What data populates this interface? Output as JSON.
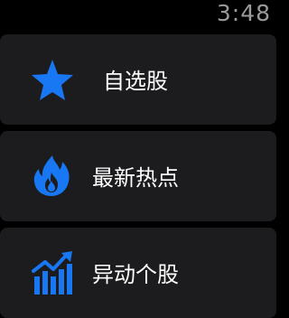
{
  "status": {
    "time": "3:48"
  },
  "accent_color": "#1877f2",
  "menu": {
    "items": [
      {
        "label": "自选股",
        "icon": "star-icon"
      },
      {
        "label": "最新热点",
        "icon": "flame-icon"
      },
      {
        "label": "异动个股",
        "icon": "rising-bar-chart-icon"
      }
    ]
  }
}
